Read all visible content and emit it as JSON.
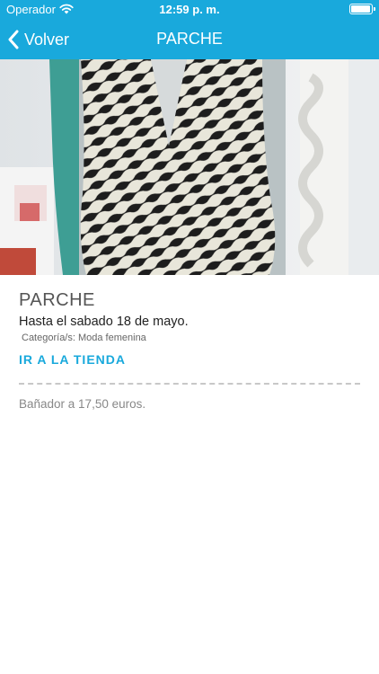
{
  "status_bar": {
    "carrier": "Operador",
    "time": "12:59 p. m.",
    "wifi_icon": "wifi-icon",
    "battery_icon": "battery-icon"
  },
  "nav": {
    "back_label": "Volver",
    "title": "PARCHE"
  },
  "colors": {
    "brand": "#19a9dc",
    "link": "#19a9dc"
  },
  "detail": {
    "store_name": "PARCHE",
    "offer": "Hasta el sabado 18 de mayo.",
    "category": "Categoría/s: Moda femenina",
    "store_link": "IR A LA TIENDA",
    "description": "Bañador a 17,50 euros."
  }
}
